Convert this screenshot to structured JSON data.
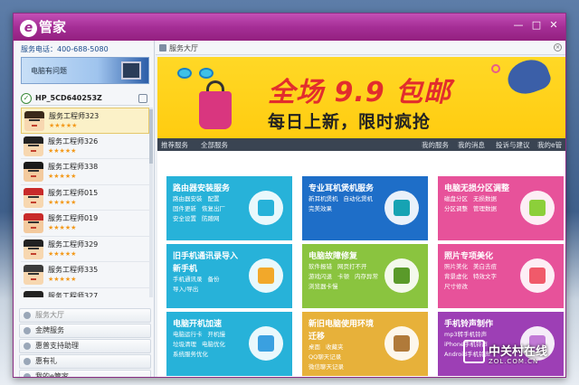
{
  "window": {
    "app_title": "管家",
    "logo_letter": "e"
  },
  "left": {
    "phone": "服务电话：400-688-5080",
    "banner_text": "电脑有问题",
    "pc_name": "HP_5CD640253Z",
    "engineers": [
      {
        "name": "服务工程师323",
        "stars": "★★★★★",
        "hair": "#3a2a1a",
        "skin": "#f7d7b0"
      },
      {
        "name": "服务工程师326",
        "stars": "★★★★★",
        "hair": "#222",
        "skin": "#f7d7b0"
      },
      {
        "name": "服务工程师338",
        "stars": "★★★★★",
        "hair": "#1a1a1a",
        "skin": "#f3ca9e"
      },
      {
        "name": "服务工程师015",
        "stars": "★★★★★",
        "hair": "#c82a2a",
        "skin": "#f7d7b0"
      },
      {
        "name": "服务工程师019",
        "stars": "★★★★★",
        "hair": "#c82a2a",
        "skin": "#f3ca9e"
      },
      {
        "name": "服务工程师329",
        "stars": "★★★★★",
        "hair": "#222",
        "skin": "#f7d7b0"
      },
      {
        "name": "服务工程师335",
        "stars": "★★★★★",
        "hair": "#3b3b3b",
        "skin": "#f7d7b0"
      },
      {
        "name": "服务工程师327",
        "stars": "★★★★★",
        "hair": "#222",
        "skin": "#f7d7b0"
      }
    ],
    "menu": [
      "服务大厅",
      "金牌服务",
      "惠普支持助理",
      "惠有礼",
      "我的e管家"
    ]
  },
  "main": {
    "tab_title": "服务大厅",
    "promo_line1": "全场 9.9 包邮",
    "promo_line2": "每日上新，限时疯抢",
    "nav_left": [
      "推荐服务",
      "全部服务"
    ],
    "nav_right": [
      "我的服务",
      "我的消息",
      "投诉与建议",
      "我的e管家"
    ],
    "tiles": [
      {
        "title": "路由器安装服务",
        "title2": "",
        "items": [
          "路由器安装",
          "配置",
          "固件更新",
          "恢复出厂",
          "安全设置",
          "防蹭网"
        ],
        "color": "#27b2d9",
        "icon_color": "#27b2d9"
      },
      {
        "title": "专业耳机煲机服务",
        "title2": "",
        "items": [
          "新耳机煲机",
          "自动化煲机",
          "完美效果"
        ],
        "color": "#1e6ec8",
        "icon_color": "#16a3b3"
      },
      {
        "title": "电脑无损分区调整",
        "title2": "",
        "items": [
          "磁盘分区",
          "无损数据",
          "分区调整",
          "管理数据"
        ],
        "color": "#e7529a",
        "icon_color": "#8ccf3a"
      },
      {
        "title": "旧手机通讯录导入",
        "title2": "新手机",
        "items": [
          "手机通讯录",
          "备份",
          "导入/导出"
        ],
        "color": "#27b2d9",
        "icon_color": "#f2a82a"
      },
      {
        "title": "电脑故障修复",
        "title2": "",
        "items": [
          "软件报错",
          "网页打不开",
          "游戏闪退",
          "卡顿",
          "内存异常",
          "浏览器卡慢"
        ],
        "color": "#8ac43f",
        "icon_color": "#5a9a2a"
      },
      {
        "title": "照片专项美化",
        "title2": "",
        "items": [
          "照片美化",
          "美白去痘",
          "背景虚化",
          "特效文字",
          "尺寸修改"
        ],
        "color": "#e7529a",
        "icon_color": "#f05a6a"
      },
      {
        "title": "电脑开机加速",
        "title2": "",
        "items": [
          "电脑运行卡",
          "开机慢",
          "垃圾清理",
          "电脑优化",
          "系统服务优化"
        ],
        "color": "#27b2d9",
        "icon_color": "#3aa0e0"
      },
      {
        "title": "新旧电脑使用环境",
        "title2": "迁移",
        "items": [
          "桌面",
          "收藏夹",
          "QQ聊天记录",
          "微信聊天记录"
        ],
        "color": "#e7b13a",
        "icon_color": "#b07a3a"
      },
      {
        "title": "手机铃声制作",
        "title2": "",
        "items": [
          "mp3转手机铃声",
          "iPhone手机铃声",
          "Android手机铃声"
        ],
        "color": "#9d3fb5",
        "icon_color": "#c27ad6"
      }
    ]
  },
  "watermark": {
    "text1": "中关村在线",
    "text2": "ZOL.COM.CN"
  }
}
